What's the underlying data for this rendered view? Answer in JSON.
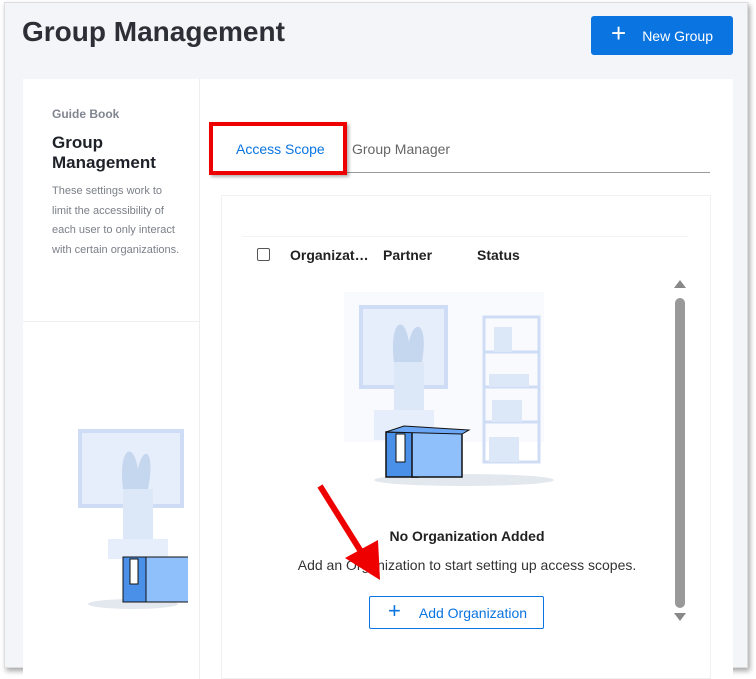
{
  "header": {
    "title": "Group Management",
    "new_group_label": "New Group"
  },
  "sidebar": {
    "guide_label": "Guide Book",
    "heading": "Group Management",
    "description": "These settings work to limit the accessibility of each user to only interact with certain organizations."
  },
  "tabs": [
    {
      "label": "Access Scope",
      "active": true
    },
    {
      "label": "Group Manager",
      "active": false
    }
  ],
  "table": {
    "columns": [
      "Organizat…",
      "Partner",
      "Status"
    ]
  },
  "empty_state": {
    "title": "No Organization Added",
    "description": "Add an Organization to start setting up access scopes.",
    "button_label": "Add Organization"
  },
  "colors": {
    "accent": "#0a74e0",
    "annotation": "#e00000"
  }
}
